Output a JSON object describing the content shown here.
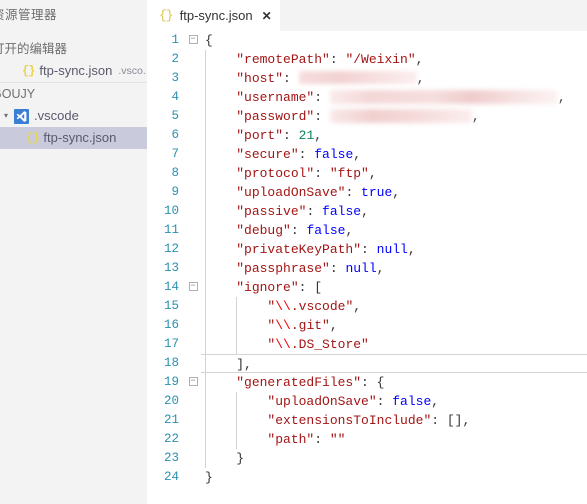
{
  "sidebar": {
    "title": "资源管理器",
    "sections": [
      {
        "label": "打开的编辑器"
      },
      {
        "label": "GOUJY"
      }
    ],
    "open_editors": [
      {
        "icon": "json-icon",
        "label": "ftp-sync.json",
        "suffix": ".vsco..."
      }
    ],
    "tree": [
      {
        "icon": "vscode-folder-icon",
        "label": ".vscode",
        "chevron": "▾",
        "selected": false
      },
      {
        "icon": "json-icon",
        "label": "ftp-sync.json",
        "selected": true
      }
    ]
  },
  "tab": {
    "icon": "json-braces-icon",
    "icon_glyph": "{}",
    "label": "ftp-sync.json",
    "close_glyph": "✕"
  },
  "editor": {
    "current_line": 18,
    "lines": [
      {
        "n": 1,
        "fold": "−",
        "indent": 0,
        "tokens": [
          {
            "t": "punct",
            "v": "{"
          }
        ]
      },
      {
        "n": 2,
        "fold": "",
        "indent": 1,
        "tokens": [
          {
            "t": "key",
            "v": "\"remotePath\""
          },
          {
            "t": "punct",
            "v": ": "
          },
          {
            "t": "str",
            "v": "\"/Weixin\""
          },
          {
            "t": "punct",
            "v": ","
          }
        ]
      },
      {
        "n": 3,
        "fold": "",
        "indent": 1,
        "tokens": [
          {
            "t": "key",
            "v": "\"host\""
          },
          {
            "t": "punct",
            "v": ": "
          },
          {
            "t": "redact",
            "v": "host"
          },
          {
            "t": "punct",
            "v": ","
          }
        ]
      },
      {
        "n": 4,
        "fold": "",
        "indent": 1,
        "tokens": [
          {
            "t": "key",
            "v": "\"username\""
          },
          {
            "t": "punct",
            "v": ": "
          },
          {
            "t": "redact",
            "v": "user"
          },
          {
            "t": "punct",
            "v": ","
          }
        ]
      },
      {
        "n": 5,
        "fold": "",
        "indent": 1,
        "tokens": [
          {
            "t": "key",
            "v": "\"password\""
          },
          {
            "t": "punct",
            "v": ": "
          },
          {
            "t": "redact",
            "v": "pass"
          },
          {
            "t": "punct",
            "v": ","
          }
        ]
      },
      {
        "n": 6,
        "fold": "",
        "indent": 1,
        "tokens": [
          {
            "t": "key",
            "v": "\"port\""
          },
          {
            "t": "punct",
            "v": ": "
          },
          {
            "t": "num",
            "v": "21"
          },
          {
            "t": "punct",
            "v": ","
          }
        ]
      },
      {
        "n": 7,
        "fold": "",
        "indent": 1,
        "tokens": [
          {
            "t": "key",
            "v": "\"secure\""
          },
          {
            "t": "punct",
            "v": ": "
          },
          {
            "t": "bool",
            "v": "false"
          },
          {
            "t": "punct",
            "v": ","
          }
        ]
      },
      {
        "n": 8,
        "fold": "",
        "indent": 1,
        "tokens": [
          {
            "t": "key",
            "v": "\"protocol\""
          },
          {
            "t": "punct",
            "v": ": "
          },
          {
            "t": "str",
            "v": "\"ftp\""
          },
          {
            "t": "punct",
            "v": ","
          }
        ]
      },
      {
        "n": 9,
        "fold": "",
        "indent": 1,
        "tokens": [
          {
            "t": "key",
            "v": "\"uploadOnSave\""
          },
          {
            "t": "punct",
            "v": ": "
          },
          {
            "t": "bool",
            "v": "true"
          },
          {
            "t": "punct",
            "v": ","
          }
        ]
      },
      {
        "n": 10,
        "fold": "",
        "indent": 1,
        "tokens": [
          {
            "t": "key",
            "v": "\"passive\""
          },
          {
            "t": "punct",
            "v": ": "
          },
          {
            "t": "bool",
            "v": "false"
          },
          {
            "t": "punct",
            "v": ","
          }
        ]
      },
      {
        "n": 11,
        "fold": "",
        "indent": 1,
        "tokens": [
          {
            "t": "key",
            "v": "\"debug\""
          },
          {
            "t": "punct",
            "v": ": "
          },
          {
            "t": "bool",
            "v": "false"
          },
          {
            "t": "punct",
            "v": ","
          }
        ]
      },
      {
        "n": 12,
        "fold": "",
        "indent": 1,
        "tokens": [
          {
            "t": "key",
            "v": "\"privateKeyPath\""
          },
          {
            "t": "punct",
            "v": ": "
          },
          {
            "t": "null",
            "v": "null"
          },
          {
            "t": "punct",
            "v": ","
          }
        ]
      },
      {
        "n": 13,
        "fold": "",
        "indent": 1,
        "tokens": [
          {
            "t": "key",
            "v": "\"passphrase\""
          },
          {
            "t": "punct",
            "v": ": "
          },
          {
            "t": "null",
            "v": "null"
          },
          {
            "t": "punct",
            "v": ","
          }
        ]
      },
      {
        "n": 14,
        "fold": "−",
        "indent": 1,
        "tokens": [
          {
            "t": "key",
            "v": "\"ignore\""
          },
          {
            "t": "punct",
            "v": ": "
          },
          {
            "t": "punct",
            "v": "["
          }
        ]
      },
      {
        "n": 15,
        "fold": "",
        "indent": 2,
        "tokens": [
          {
            "t": "str",
            "v": "\""
          },
          {
            "t": "esc",
            "v": "\\\\"
          },
          {
            "t": "str",
            "v": ".vscode\""
          },
          {
            "t": "punct",
            "v": ","
          }
        ]
      },
      {
        "n": 16,
        "fold": "",
        "indent": 2,
        "tokens": [
          {
            "t": "str",
            "v": "\""
          },
          {
            "t": "esc",
            "v": "\\\\"
          },
          {
            "t": "str",
            "v": ".git\""
          },
          {
            "t": "punct",
            "v": ","
          }
        ]
      },
      {
        "n": 17,
        "fold": "",
        "indent": 2,
        "tokens": [
          {
            "t": "str",
            "v": "\""
          },
          {
            "t": "esc",
            "v": "\\\\"
          },
          {
            "t": "str",
            "v": ".DS_Store\""
          }
        ]
      },
      {
        "n": 18,
        "fold": "",
        "indent": 1,
        "tokens": [
          {
            "t": "punct",
            "v": "]"
          },
          {
            "t": "punct",
            "v": ","
          }
        ]
      },
      {
        "n": 19,
        "fold": "−",
        "indent": 1,
        "tokens": [
          {
            "t": "key",
            "v": "\"generatedFiles\""
          },
          {
            "t": "punct",
            "v": ": "
          },
          {
            "t": "punct",
            "v": "{"
          }
        ]
      },
      {
        "n": 20,
        "fold": "",
        "indent": 2,
        "tokens": [
          {
            "t": "key",
            "v": "\"uploadOnSave\""
          },
          {
            "t": "punct",
            "v": ": "
          },
          {
            "t": "bool",
            "v": "false"
          },
          {
            "t": "punct",
            "v": ","
          }
        ]
      },
      {
        "n": 21,
        "fold": "",
        "indent": 2,
        "tokens": [
          {
            "t": "key",
            "v": "\"extensionsToInclude\""
          },
          {
            "t": "punct",
            "v": ": "
          },
          {
            "t": "punct",
            "v": "[]"
          },
          {
            "t": "punct",
            "v": ","
          }
        ]
      },
      {
        "n": 22,
        "fold": "",
        "indent": 2,
        "tokens": [
          {
            "t": "key",
            "v": "\"path\""
          },
          {
            "t": "punct",
            "v": ": "
          },
          {
            "t": "str",
            "v": "\"\""
          }
        ]
      },
      {
        "n": 23,
        "fold": "",
        "indent": 1,
        "tokens": [
          {
            "t": "punct",
            "v": "}"
          }
        ]
      },
      {
        "n": 24,
        "fold": "",
        "indent": 0,
        "tokens": [
          {
            "t": "punct",
            "v": "}"
          }
        ]
      }
    ]
  },
  "colors": {
    "key": "#a31515",
    "string": "#a31515",
    "number": "#098658",
    "boolean": "#0000ff",
    "linenumber": "#2b91af",
    "sidebar_bg": "#f3f3f3",
    "selection_bg": "#c9cbdd",
    "json_icon": "#e0c24a"
  }
}
